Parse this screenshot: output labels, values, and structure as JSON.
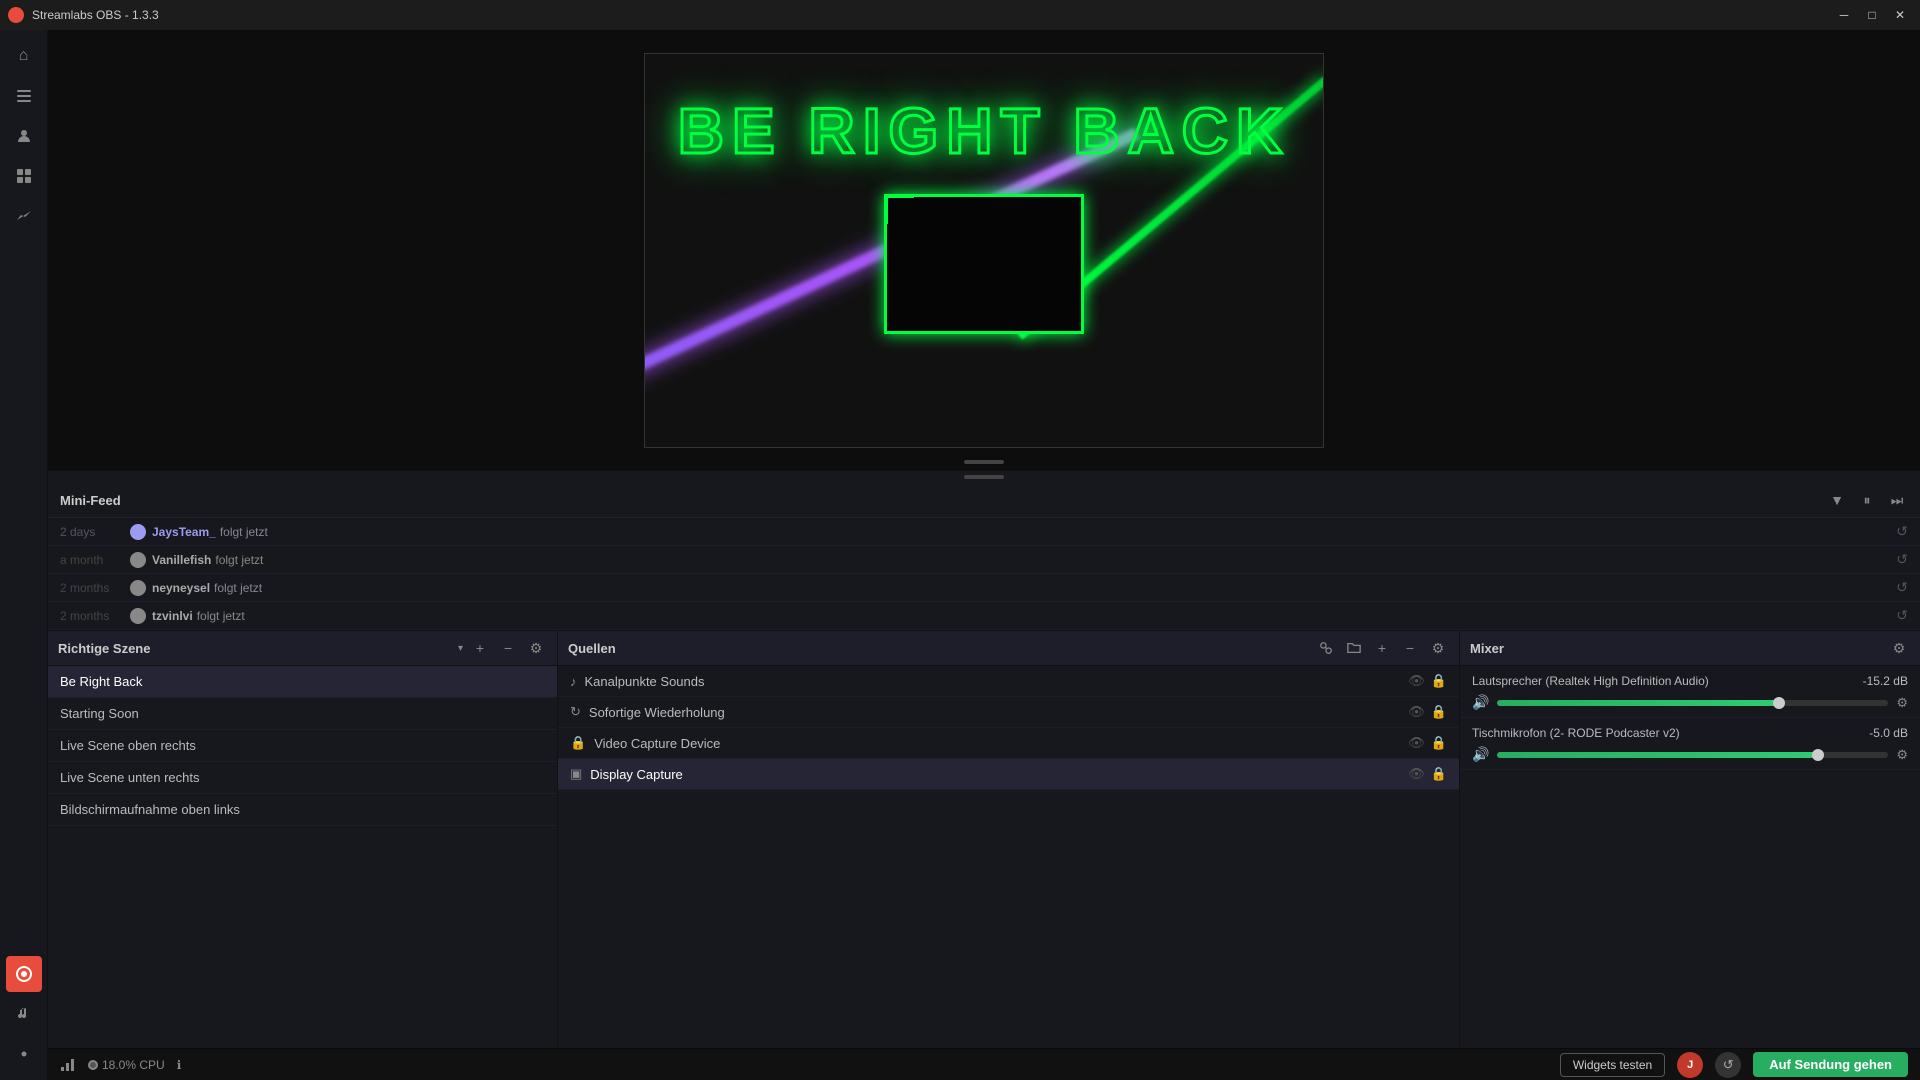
{
  "titlebar": {
    "title": "Streamlabs OBS - 1.3.3",
    "minimize_label": "─",
    "maximize_label": "□",
    "close_label": "✕"
  },
  "sidebar": {
    "items": [
      {
        "id": "home",
        "icon": "⌂",
        "label": "Home"
      },
      {
        "id": "feed",
        "icon": "≡",
        "label": "Feed"
      },
      {
        "id": "users",
        "icon": "☺",
        "label": "Users"
      },
      {
        "id": "store",
        "icon": "⊞",
        "label": "Store"
      },
      {
        "id": "stats",
        "icon": "↑",
        "label": "Stats"
      }
    ],
    "bottom_items": [
      {
        "id": "alert",
        "icon": "◉",
        "label": "Alert",
        "highlight": true
      },
      {
        "id": "music",
        "icon": "♪",
        "label": "Music"
      },
      {
        "id": "settings",
        "icon": "☰",
        "label": "Settings"
      }
    ]
  },
  "preview": {
    "brb_text": "BE RIGHT BACK"
  },
  "minifeed": {
    "title": "Mini-Feed",
    "rows": [
      {
        "time": "2 days",
        "username": "JaysTeam_",
        "action": "folgt jetzt",
        "avatar_color": "#9b9bf0"
      },
      {
        "time": "a month",
        "username": "Vanillefish",
        "action": "folgt jetzt",
        "avatar_color": "#888"
      },
      {
        "time": "2 months",
        "username": "neyneysel",
        "action": "folgt jetzt",
        "avatar_color": "#888"
      },
      {
        "time": "2 months",
        "username": "tzvinlvi",
        "action": "folgt jetzt",
        "avatar_color": "#888"
      }
    ]
  },
  "scenes": {
    "title": "Richtige Szene",
    "items": [
      {
        "name": "Be Right Back",
        "active": true
      },
      {
        "name": "Starting Soon",
        "active": false
      },
      {
        "name": "Live Scene oben rechts",
        "active": false
      },
      {
        "name": "Live Scene unten rechts",
        "active": false
      },
      {
        "name": "Bildschirmaufnahme oben links",
        "active": false
      }
    ]
  },
  "sources": {
    "title": "Quellen",
    "items": [
      {
        "name": "Kanalpunkte Sounds",
        "icon": "♪",
        "type": "audio"
      },
      {
        "name": "Sofortige Wiederholung",
        "icon": "↻",
        "type": "replay"
      },
      {
        "name": "Video Capture Device",
        "icon": "🔒",
        "type": "video"
      },
      {
        "name": "Display Capture",
        "icon": "▣",
        "type": "display",
        "active": true
      }
    ]
  },
  "mixer": {
    "title": "Mixer",
    "channels": [
      {
        "name": "Lautsprecher (Realtek High Definition Audio)",
        "db": "-15.2 dB",
        "fill_percent": 72,
        "handle_percent": 72
      },
      {
        "name": "Tischmikrofon (2- RODE Podcaster v2)",
        "db": "-5.0 dB",
        "fill_percent": 82,
        "handle_percent": 82
      }
    ]
  },
  "statusbar": {
    "cpu_icon": "⊙",
    "cpu_label": "18.0% CPU",
    "info_icon": "ℹ",
    "widgets_label": "Widgets testen",
    "live_label": "Auf Sendung gehen"
  },
  "icons": {
    "filter": "▼",
    "pause": "⏸",
    "skip": "⏭",
    "settings": "⚙",
    "add": "+",
    "remove": "−",
    "replay": "↺",
    "eye": "👁",
    "lock": "🔒",
    "gear": "⚙",
    "volume": "🔊",
    "chart": "📊"
  }
}
